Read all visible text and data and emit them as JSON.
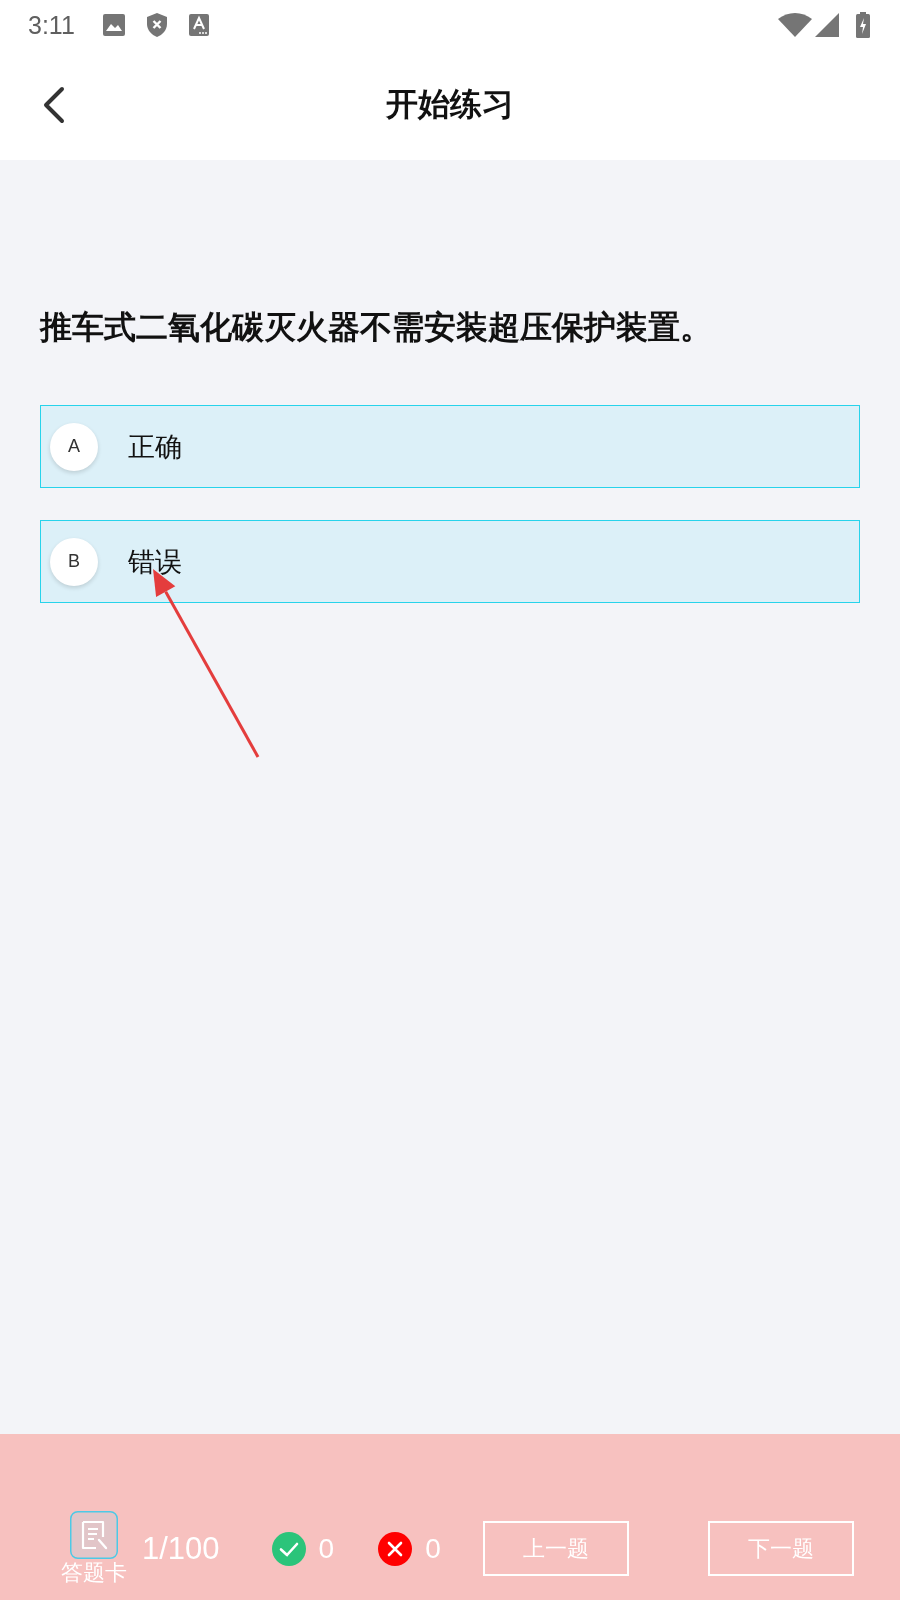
{
  "status_bar": {
    "time": "3:11"
  },
  "header": {
    "title": "开始练习"
  },
  "question": {
    "text": "推车式二氧化碳灭火器不需安装超压保护装置。",
    "options": [
      {
        "letter": "A",
        "text": "正确"
      },
      {
        "letter": "B",
        "text": "错误"
      }
    ]
  },
  "footer": {
    "answer_card_label": "答题卡",
    "progress": "1/100",
    "correct_count": "0",
    "wrong_count": "0",
    "buttons": [
      {
        "label": "上一题"
      },
      {
        "label": "下一题"
      }
    ]
  }
}
